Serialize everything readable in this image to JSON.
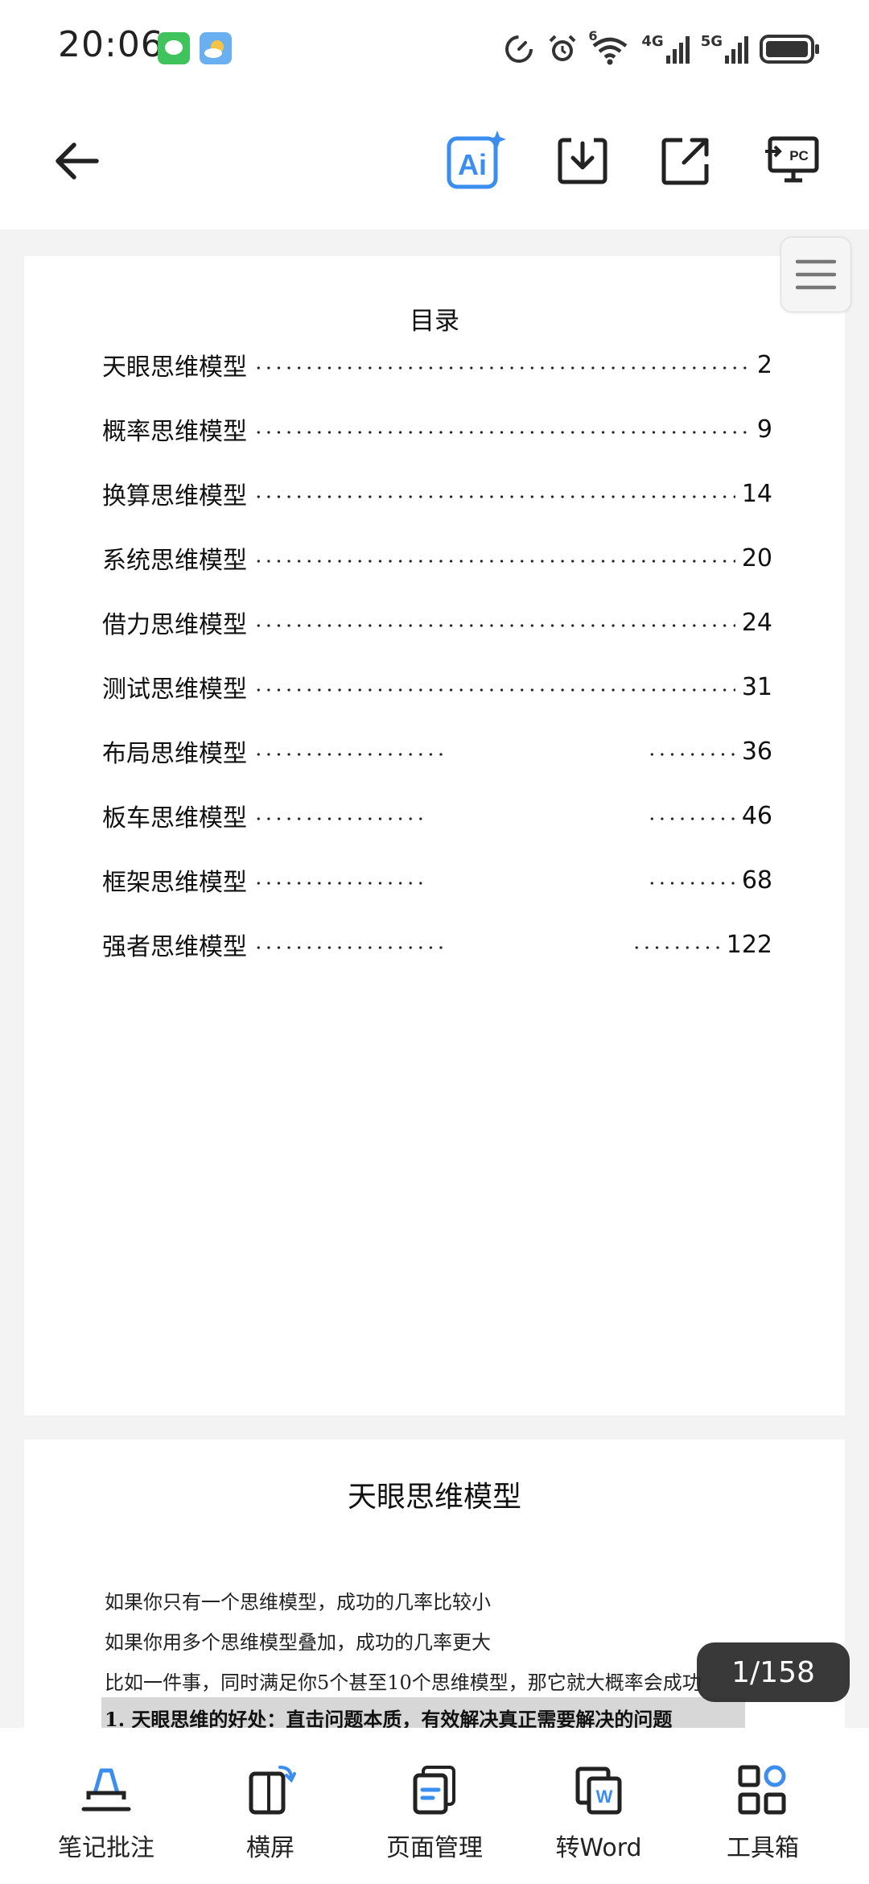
{
  "status_bar": {
    "time": "20:06",
    "network_1": "4G",
    "network_2": "5G",
    "wifi_badge": "6"
  },
  "toolbar": {
    "back_icon": "arrow-left-icon",
    "ai_icon": "ai-sparkle-icon",
    "download_icon": "download-icon",
    "share_icon": "share-icon",
    "pc_icon": "pc-cast-icon",
    "ai_label": "Ai",
    "pc_label": "PC",
    "accent": "#3b8ef0"
  },
  "toc": {
    "title": "目录",
    "items": [
      {
        "label": "天眼思维模型",
        "page": "2"
      },
      {
        "label": "概率思维模型",
        "page": "9"
      },
      {
        "label": "换算思维模型",
        "page": "14"
      },
      {
        "label": "系统思维模型",
        "page": "20"
      },
      {
        "label": "借力思维模型",
        "page": "24"
      },
      {
        "label": "测试思维模型",
        "page": "31"
      },
      {
        "label": "布局思维模型",
        "page": "36"
      },
      {
        "label": "板车思维模型",
        "page": "46"
      },
      {
        "label": "框架思维模型",
        "page": "68"
      },
      {
        "label": "强者思维模型",
        "page": "122"
      }
    ]
  },
  "page2": {
    "title": "天眼思维模型",
    "lines": [
      "如果你只有一个思维模型，成功的几率比较小",
      "如果你用多个思维模型叠加，成功的几率更大",
      "比如一件事，同时满足你5个甚至10个思维模型，那它就大概率会成功"
    ],
    "heading": "1. 天眼思维的好处：直击问题本质，有效解决真正需要解决的问题"
  },
  "page_indicator": "1/158",
  "bottom_bar": {
    "items": [
      {
        "label": "笔记批注",
        "icon": "pen-note-icon"
      },
      {
        "label": "横屏",
        "icon": "rotate-screen-icon"
      },
      {
        "label": "页面管理",
        "icon": "pages-icon"
      },
      {
        "label": "转Word",
        "icon": "word-convert-icon"
      },
      {
        "label": "工具箱",
        "icon": "toolbox-icon"
      }
    ]
  }
}
